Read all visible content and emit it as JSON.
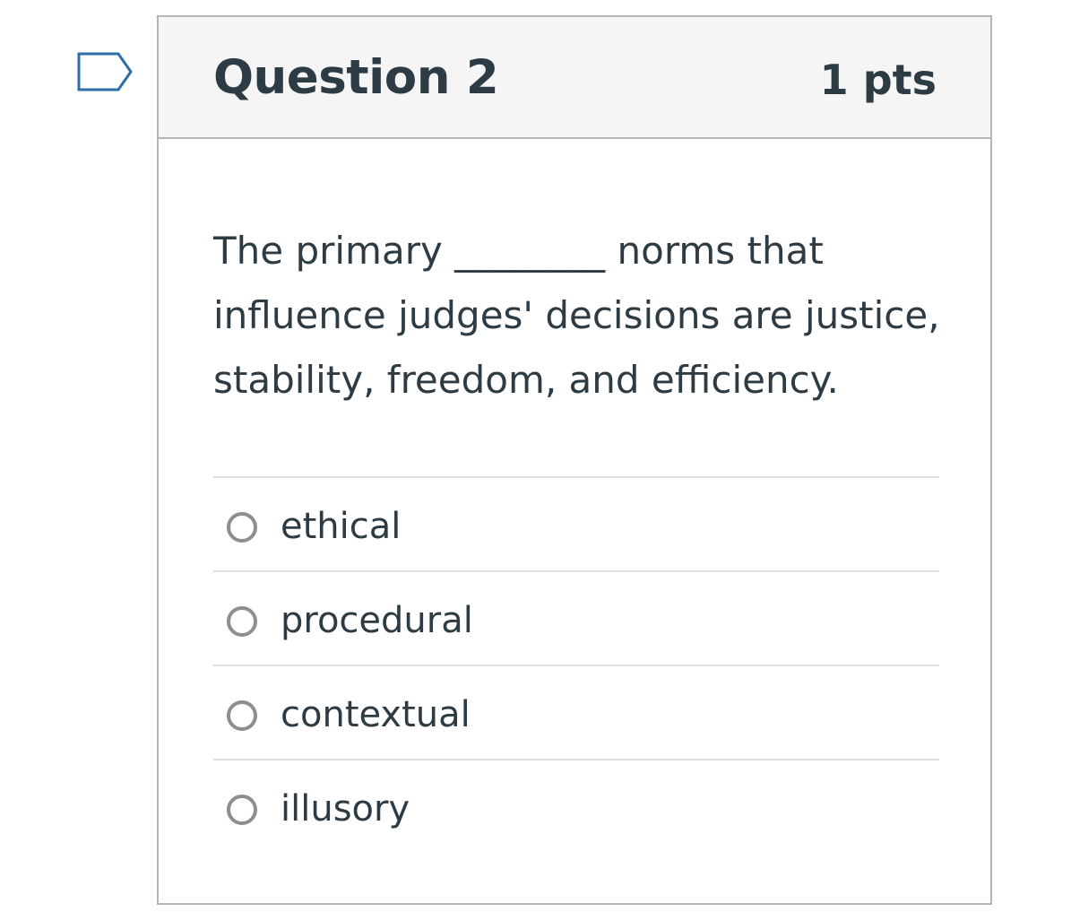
{
  "question": {
    "title": "Question 2",
    "points": "1 pts",
    "text": "The primary ________ norms that influence judges' decisions are justice, stability, freedom, and efficiency."
  },
  "answers": [
    {
      "label": "ethical",
      "selected": false
    },
    {
      "label": "procedural",
      "selected": false
    },
    {
      "label": "contextual",
      "selected": false
    },
    {
      "label": "illusory",
      "selected": false
    }
  ],
  "icons": {
    "flag": "flag-question-icon"
  },
  "colors": {
    "text": "#2d3b45",
    "header_bg": "#f5f5f5",
    "border": "#b4b7ba",
    "divider": "#dcdedf",
    "radio": "#8b8f92",
    "flag": "#2d6ea8"
  }
}
